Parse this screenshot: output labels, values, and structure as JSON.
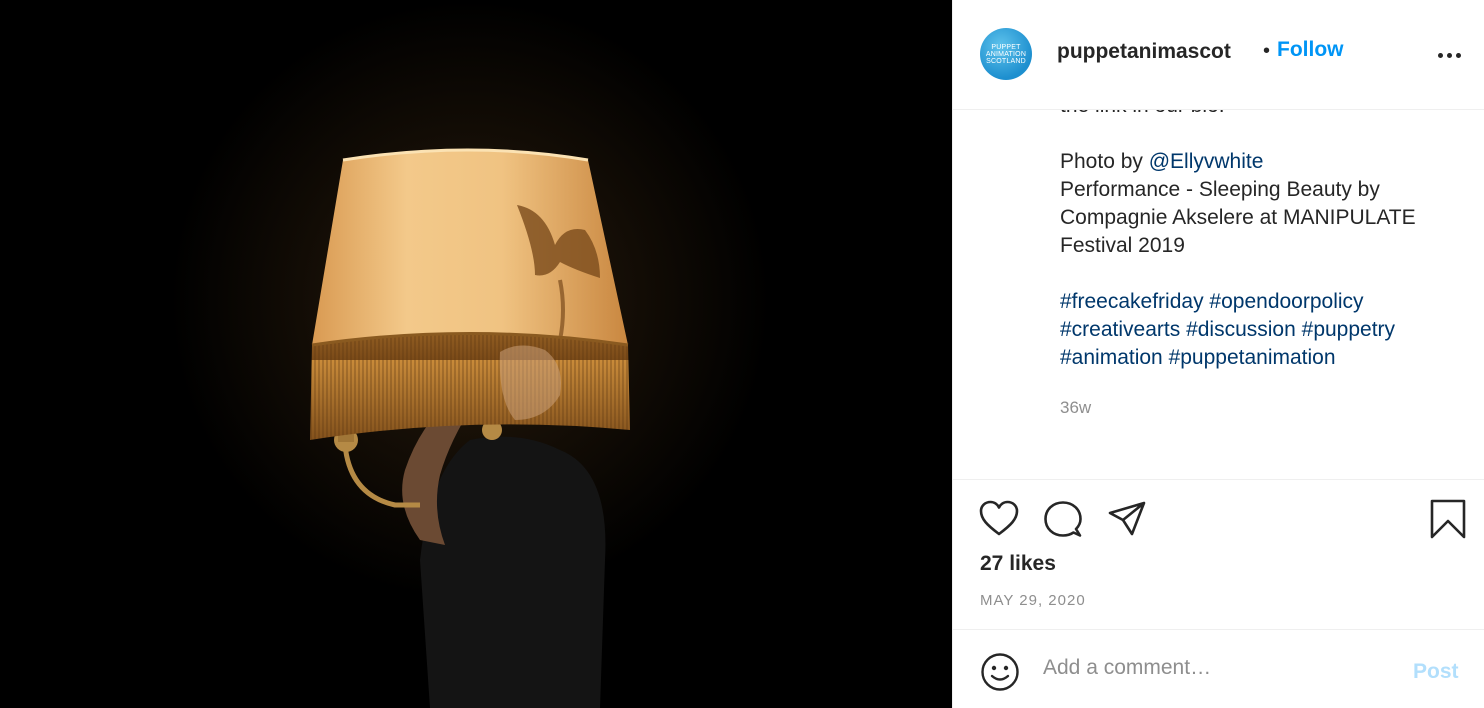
{
  "post": {
    "photo_alt": "",
    "colors": {
      "accent": "#0095f6",
      "link": "#00376b",
      "post_disabled": "#b2dffc",
      "muted": "#8e8e8e"
    }
  },
  "header": {
    "avatar_text": "PUPPET\nANIMATION\nSCOTLAND",
    "username": "puppetanimascot",
    "separator": "•",
    "follow_label": "Follow",
    "more_icon": "more-horizontal-icon"
  },
  "caption": {
    "cut_line": "the link in our bio.",
    "photo_by_prefix": "Photo by ",
    "photo_by_handle": "@Ellyvwhite",
    "performance_line1": "Performance - Sleeping Beauty by",
    "performance_line2": "Compagnie Akselere at MANIPULATE",
    "performance_line3": "Festival 2019",
    "hashtags_line1": [
      "#freecakefriday",
      "#opendoorpolicy"
    ],
    "hashtags_line2": [
      "#creativearts",
      "#discussion",
      "#puppetry"
    ],
    "hashtags_line3": [
      "#animation",
      "#puppetanimation"
    ],
    "age": "36w"
  },
  "actions": {
    "icons": [
      "heart-icon",
      "comment-icon",
      "share-icon",
      "bookmark-icon"
    ],
    "likes": "27 likes",
    "date": "MAY 29, 2020"
  },
  "comment": {
    "emoji_icon": "emoji-icon",
    "placeholder": "Add a comment…",
    "post_label": "Post"
  }
}
